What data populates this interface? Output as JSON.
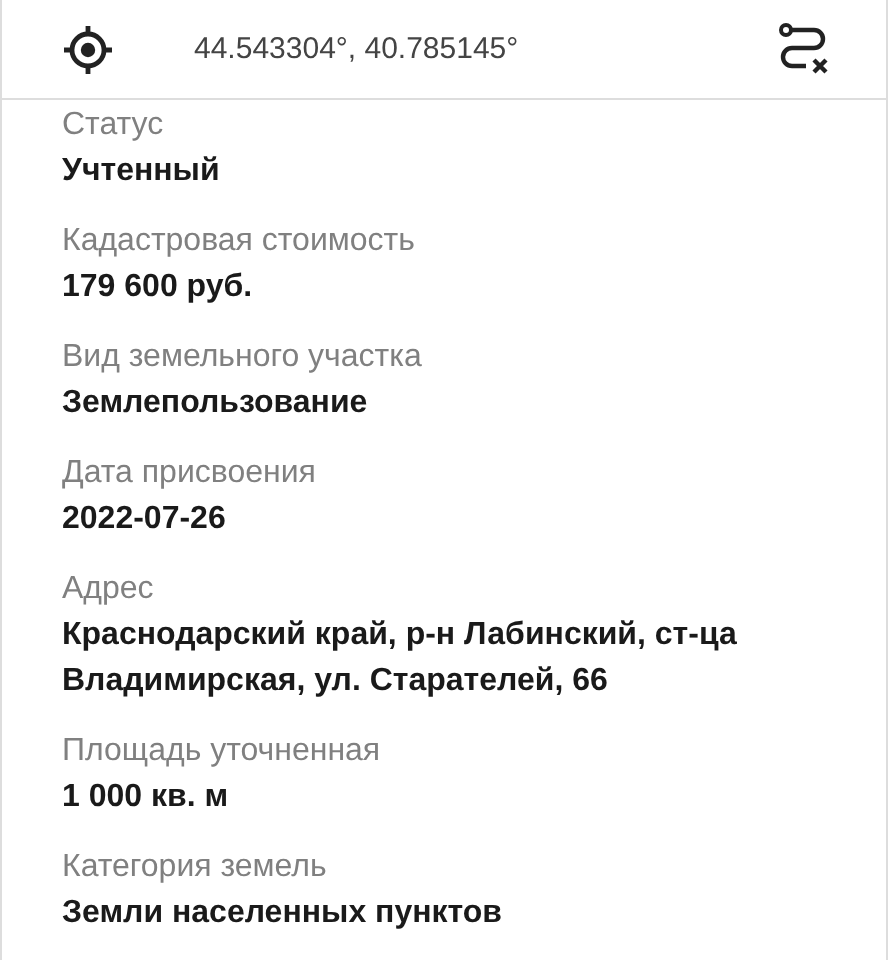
{
  "header": {
    "coordinates": "44.543304°, 40.785145°"
  },
  "fields": [
    {
      "label": "Статус",
      "value": "Учтенный"
    },
    {
      "label": "Кадастровая стоимость",
      "value": "179 600 руб."
    },
    {
      "label": "Вид земельного участка",
      "value": "Землепользование"
    },
    {
      "label": "Дата присвоения",
      "value": "2022-07-26"
    },
    {
      "label": "Адрес",
      "value": "Краснодарский край, р-н Лабинский, ст-ца Владимирская, ул. Старателей, 66"
    },
    {
      "label": "Площадь уточненная",
      "value": "1 000 кв. м"
    },
    {
      "label": "Категория земель",
      "value": "Земли населенных пунктов"
    }
  ]
}
